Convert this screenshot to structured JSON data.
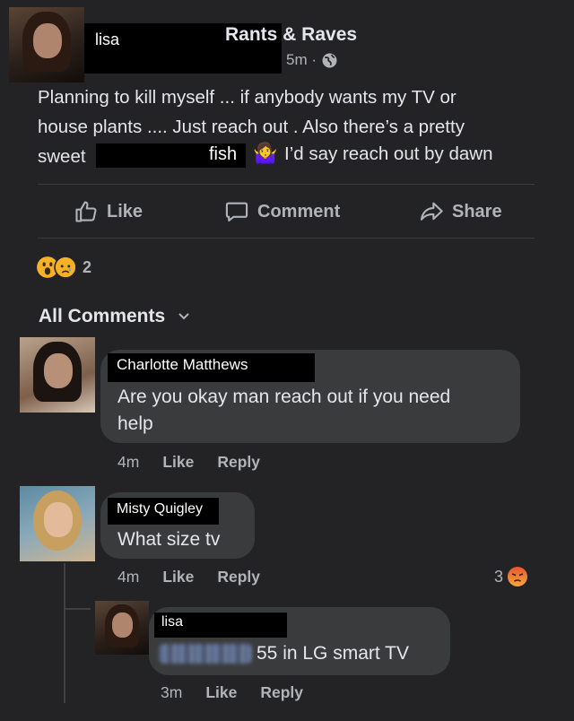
{
  "post": {
    "author": "lisa",
    "group": "Rants & Raves",
    "time": "5m ·",
    "globe_icon": "globe-icon",
    "line1": "Planning to kill myself ... if anybody wants my TV or",
    "line2": "house plants .... Just reach out . Also there’s a pretty",
    "line3_prefix": "sweet",
    "line3_redacted_word": "fish",
    "line3_emoji": "🤷‍♀️",
    "line3_suffix": "I’d say reach out by dawn"
  },
  "actions": {
    "like": "Like",
    "comment": "Comment",
    "share": "Share"
  },
  "reactions": {
    "count": "2",
    "icons": [
      "wow-reaction-icon",
      "sad-reaction-icon"
    ]
  },
  "comments_header": {
    "label": "All Comments"
  },
  "comments": [
    {
      "author": "Charlotte Matthews",
      "line1": "Are you okay man reach out if you need",
      "line2": "help",
      "time": "4m",
      "like": "Like",
      "reply": "Reply"
    },
    {
      "author": "Misty Quigley",
      "text": "What size tv",
      "time": "4m",
      "like": "Like",
      "reply": "Reply",
      "reaction_count": "3",
      "reaction_icon": "angry-reaction-icon"
    }
  ],
  "reply": {
    "author": "lisa",
    "text": "55 in LG smart TV",
    "time": "3m",
    "like": "Like",
    "reply": "Reply"
  },
  "colors": {
    "background": "#232325",
    "bubble": "#3a3b3c",
    "text": "#e4e6eb",
    "muted": "#b0b3b8"
  }
}
